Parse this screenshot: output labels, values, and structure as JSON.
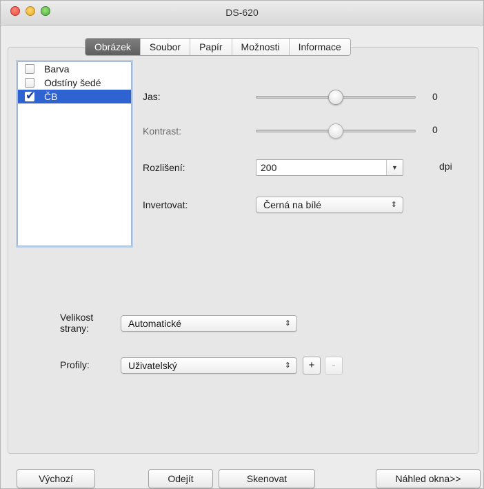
{
  "window": {
    "title": "DS-620"
  },
  "tabs": [
    "Obrázek",
    "Soubor",
    "Papír",
    "Možnosti",
    "Informace"
  ],
  "active_tab": "Obrázek",
  "color_modes": [
    {
      "label": "Barva",
      "checked": false
    },
    {
      "label": "Odstíny šedé",
      "checked": false
    },
    {
      "label": "ČB",
      "checked": true
    }
  ],
  "brightness": {
    "label": "Jas:",
    "value": "0",
    "level": 0.5
  },
  "contrast": {
    "label": "Kontrast:",
    "value": "0",
    "level": 0.5,
    "enabled": false
  },
  "resolution": {
    "label": "Rozlišení:",
    "value": "200",
    "unit": "dpi"
  },
  "invert": {
    "label": "Invertovat:",
    "value": "Černá na bílé"
  },
  "page_size": {
    "label_line1": "Velikost",
    "label_line2": "strany:",
    "value": "Automatické"
  },
  "profiles": {
    "label": "Profily:",
    "value": "Uživatelský",
    "add": "+",
    "remove": "-"
  },
  "buttons": {
    "default": "Výchozí",
    "close": "Odejít",
    "scan": "Skenovat",
    "preview": "Náhled okna>>"
  },
  "icons": {
    "dropdown": "▼",
    "updown": "⇕",
    "check": "✔"
  }
}
